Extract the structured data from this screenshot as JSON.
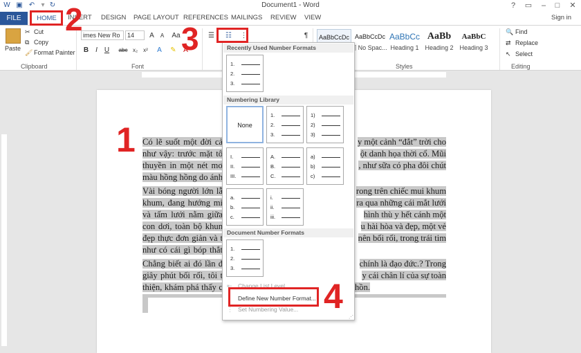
{
  "window": {
    "title": "Document1 - Word"
  },
  "tabs": {
    "file": "FILE",
    "home": "HOME",
    "insert": "INSERT",
    "design": "DESIGN",
    "page_layout": "PAGE LAYOUT",
    "references": "REFERENCES",
    "mailings": "MAILINGS",
    "review": "REVIEW",
    "view": "VIEW",
    "sign_in": "Sign in"
  },
  "clipboard": {
    "paste": "Paste",
    "cut": "Cut",
    "copy": "Copy",
    "format_painter": "Format Painter",
    "label": "Clipboard"
  },
  "font": {
    "name": "imes New Ro",
    "size": "14",
    "label": "Font"
  },
  "styles": {
    "label": "Styles",
    "items": [
      {
        "sample": "AaBbCcDc",
        "name": ""
      },
      {
        "sample": "AaBbCcDc",
        "name": "¶ No Spac..."
      },
      {
        "sample": "AaBbCc",
        "name": "Heading 1"
      },
      {
        "sample": "AaBb",
        "name": "Heading 2"
      },
      {
        "sample": "AaBbC",
        "name": "Heading 3"
      }
    ]
  },
  "editing": {
    "label": "Editing",
    "find": "Find",
    "replace": "Replace",
    "select": "Select"
  },
  "number_dropdown": {
    "recent_header": "Recently Used Number Formats",
    "library_header": "Numbering Library",
    "document_header": "Document Number Formats",
    "none_label": "None",
    "recent": [
      [
        "1.",
        "2.",
        "3."
      ]
    ],
    "library": [
      [
        "1.",
        "2.",
        "3."
      ],
      [
        "1)",
        "2)",
        "3)"
      ],
      [
        "I.",
        "II.",
        "III."
      ],
      [
        "A.",
        "B.",
        "C."
      ],
      [
        "a)",
        "b)",
        "c)"
      ],
      [
        "a.",
        "b.",
        "c."
      ],
      [
        "i.",
        "ii.",
        "iii."
      ]
    ],
    "document": [
      [
        "1.",
        "2.",
        "3."
      ]
    ],
    "change_list_level": "Change List Level",
    "define_new": "Define New Number Format...",
    "set_value": "Set Numbering Value..."
  },
  "document": {
    "para1": [
      "Có lẽ suốt một đời cả",
      "y một cảnh “đắt” trời cho",
      "như vậy: trước mặt tô",
      "ột danh họa thời cổ. Mũi",
      "thuyền in một nét mơ",
      ", như sữa có pha đôi chút",
      "màu hồng hồng do ánh"
    ],
    "para2": [
      "Vài bóng người lớn lẫ",
      "rong trên chiếc mui khum",
      "khum, đang hướng mi",
      "ra qua những cái mắt lưới",
      "và tấm lưới nằm giữa",
      "hình thù y hết cánh một",
      "con dơi, toàn bộ khun",
      "u hài hòa và đẹp, một vẻ",
      "đẹp thực đơn giản và t",
      "nên bối rối, trong trái tim",
      "như có cái gì bóp thắt"
    ],
    "para3": [
      "Chẳng biết ai đó lần đ",
      "chính là đạo đức.? Trong",
      "giây phút bối rối, tôi t",
      "y cái chân lí của sự toàn",
      "thiện, khám phá thấy c",
      "hồn."
    ]
  },
  "annotations": {
    "n1": "1",
    "n2": "2",
    "n3": "3",
    "n4": "4"
  }
}
